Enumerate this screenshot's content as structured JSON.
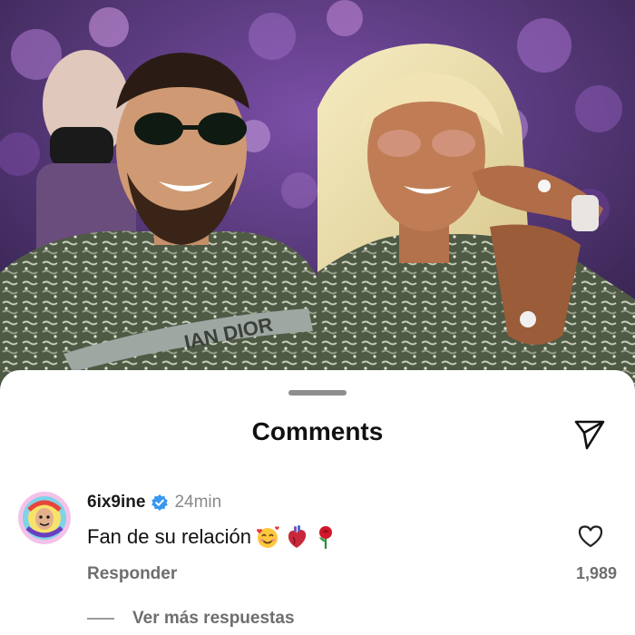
{
  "colors": {
    "accent_blue": "#3897f0",
    "text_primary": "#111111",
    "text_secondary": "#6e6e6e",
    "timestamp": "#8a8a8a",
    "sheet_bg": "#ffffff",
    "photo_crowd": "#4a2f6a"
  },
  "photo": {
    "jacket_print": "IAN DIOR"
  },
  "comments_sheet": {
    "title": "Comments",
    "share_icon": "paper-plane-icon",
    "comment": {
      "username": "6ix9ine",
      "verified_icon": "verified-badge-icon",
      "timestamp": "24min",
      "text": "Fan de su relación",
      "emojis": [
        "smiling-face-with-hearts-emoji",
        "anatomical-heart-emoji",
        "rose-emoji"
      ],
      "reply_label": "Responder",
      "like_icon": "heart-outline-icon",
      "like_count": "1,989"
    },
    "more_replies_label": "Ver más respuestas"
  }
}
